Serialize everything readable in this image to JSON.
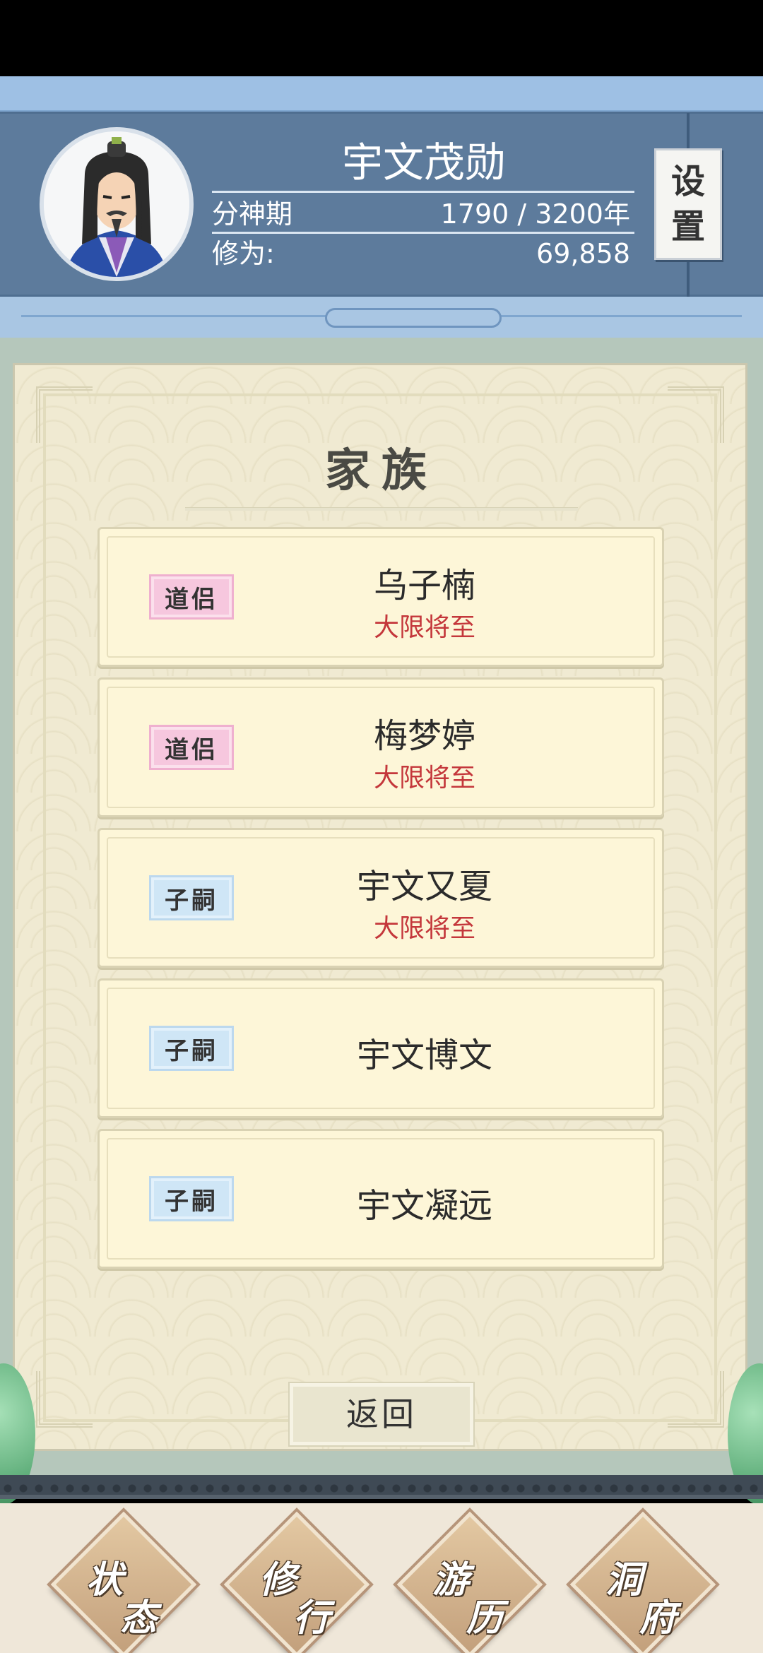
{
  "player": {
    "name": "宇文茂勋",
    "stage": "分神期",
    "age": "1790 / 3200年",
    "cultivation_label": "修为:",
    "cultivation_value": "69,858"
  },
  "settings": {
    "char1": "设",
    "char2": "置"
  },
  "panel": {
    "title": "家族",
    "members": [
      {
        "role": "道侣",
        "role_color": "pink",
        "name": "乌子楠",
        "status": "大限将至"
      },
      {
        "role": "道侣",
        "role_color": "pink",
        "name": "梅梦婷",
        "status": "大限将至"
      },
      {
        "role": "子嗣",
        "role_color": "blue",
        "name": "宇文又夏",
        "status": "大限将至"
      },
      {
        "role": "子嗣",
        "role_color": "blue",
        "name": "宇文博文",
        "status": ""
      },
      {
        "role": "子嗣",
        "role_color": "blue",
        "name": "宇文凝远",
        "status": ""
      }
    ],
    "back_label": "返回"
  },
  "nav": [
    {
      "c1": "状",
      "c2": "态"
    },
    {
      "c1": "修",
      "c2": "行"
    },
    {
      "c1": "游",
      "c2": "历"
    },
    {
      "c1": "洞",
      "c2": "府"
    }
  ],
  "colors": {
    "header_panel": "#5d7b9c",
    "status_red": "#c4373b",
    "badge_pink": "#f6c7de",
    "badge_blue": "#cfe6f6"
  }
}
